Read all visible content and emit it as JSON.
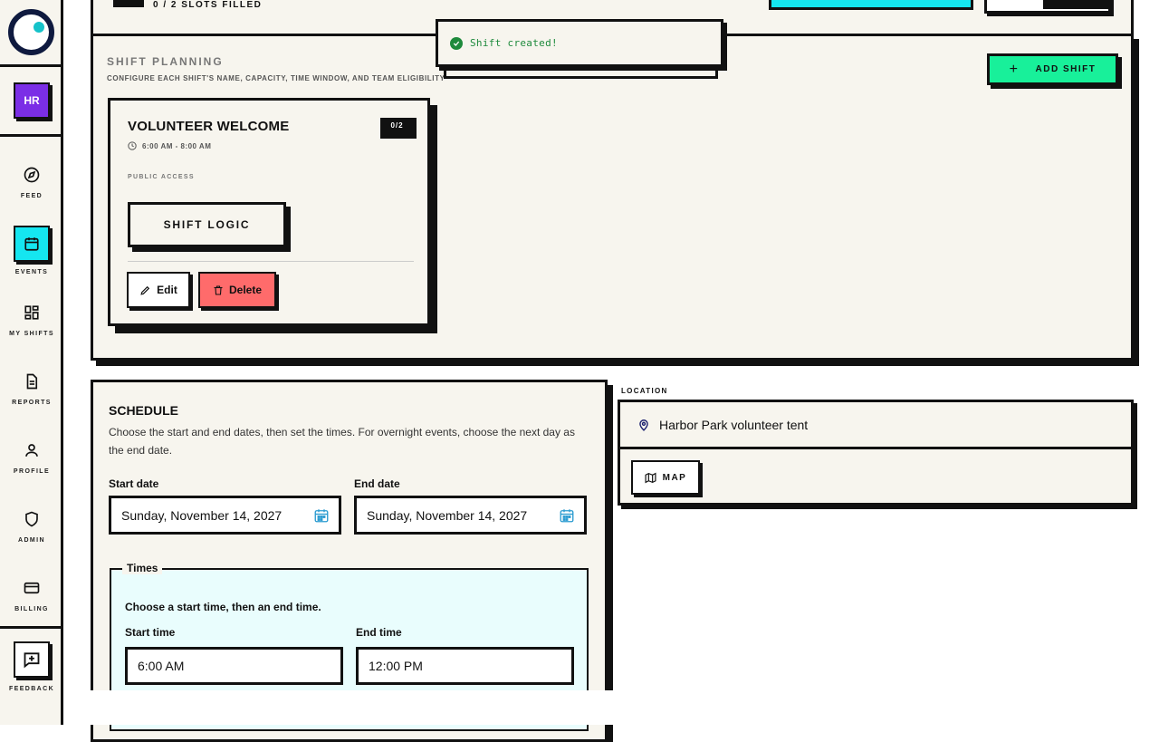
{
  "sidebar": {
    "user_initials": "HR",
    "nav": [
      {
        "label": "FEED",
        "icon": "compass-icon"
      },
      {
        "label": "EVENTS",
        "icon": "calendar-icon"
      },
      {
        "label": "MY SHIFTS",
        "icon": "grid-icon"
      },
      {
        "label": "REPORTS",
        "icon": "document-icon"
      },
      {
        "label": "PROFILE",
        "icon": "user-icon"
      },
      {
        "label": "ADMIN",
        "icon": "shield-icon"
      },
      {
        "label": "BILLING",
        "icon": "credit-card-icon"
      }
    ],
    "feedback_label": "FEEDBACK",
    "active_item": "EVENTS"
  },
  "top_panel": {
    "slots_text": "0 / 2 SLOTS FILLED"
  },
  "toast": {
    "message": "Shift created!",
    "color": "#1e8a3c"
  },
  "shift_planning": {
    "title": "SHIFT PLANNING",
    "subtitle": "CONFIGURE EACH SHIFT'S NAME, CAPACITY, TIME WINDOW, AND TEAM ELIGIBILITY",
    "add_button": "ADD SHIFT",
    "shifts": [
      {
        "name": "VOLUNTEER WELCOME",
        "time": "6:00 AM - 8:00 AM",
        "capacity": "0/2",
        "access": "PUBLIC ACCESS",
        "logic_button": "SHIFT LOGIC",
        "edit_label": "Edit",
        "delete_label": "Delete"
      }
    ]
  },
  "schedule": {
    "title": "SCHEDULE",
    "description": "Choose the start and end dates, then set the times. For overnight events, choose the next day as the end date.",
    "start_date_label": "Start date",
    "start_date": "Sunday, November 14, 2027",
    "end_date_label": "End date",
    "end_date": "Sunday, November 14, 2027",
    "times": {
      "legend": "Times",
      "hint": "Choose a start time, then an end time.",
      "start_label": "Start time",
      "start_value": "6:00 AM",
      "end_label": "End time",
      "end_value": "12:00 PM"
    }
  },
  "location": {
    "label": "LOCATION",
    "value": "Harbor Park volunteer tent",
    "map_button": "MAP"
  },
  "colors": {
    "accent_cyan": "#15e6f0",
    "accent_green": "#18f09a",
    "danger": "#ff6b6b",
    "avatar_purple": "#7b2ee6",
    "panel_bg": "#f7f5ee"
  }
}
